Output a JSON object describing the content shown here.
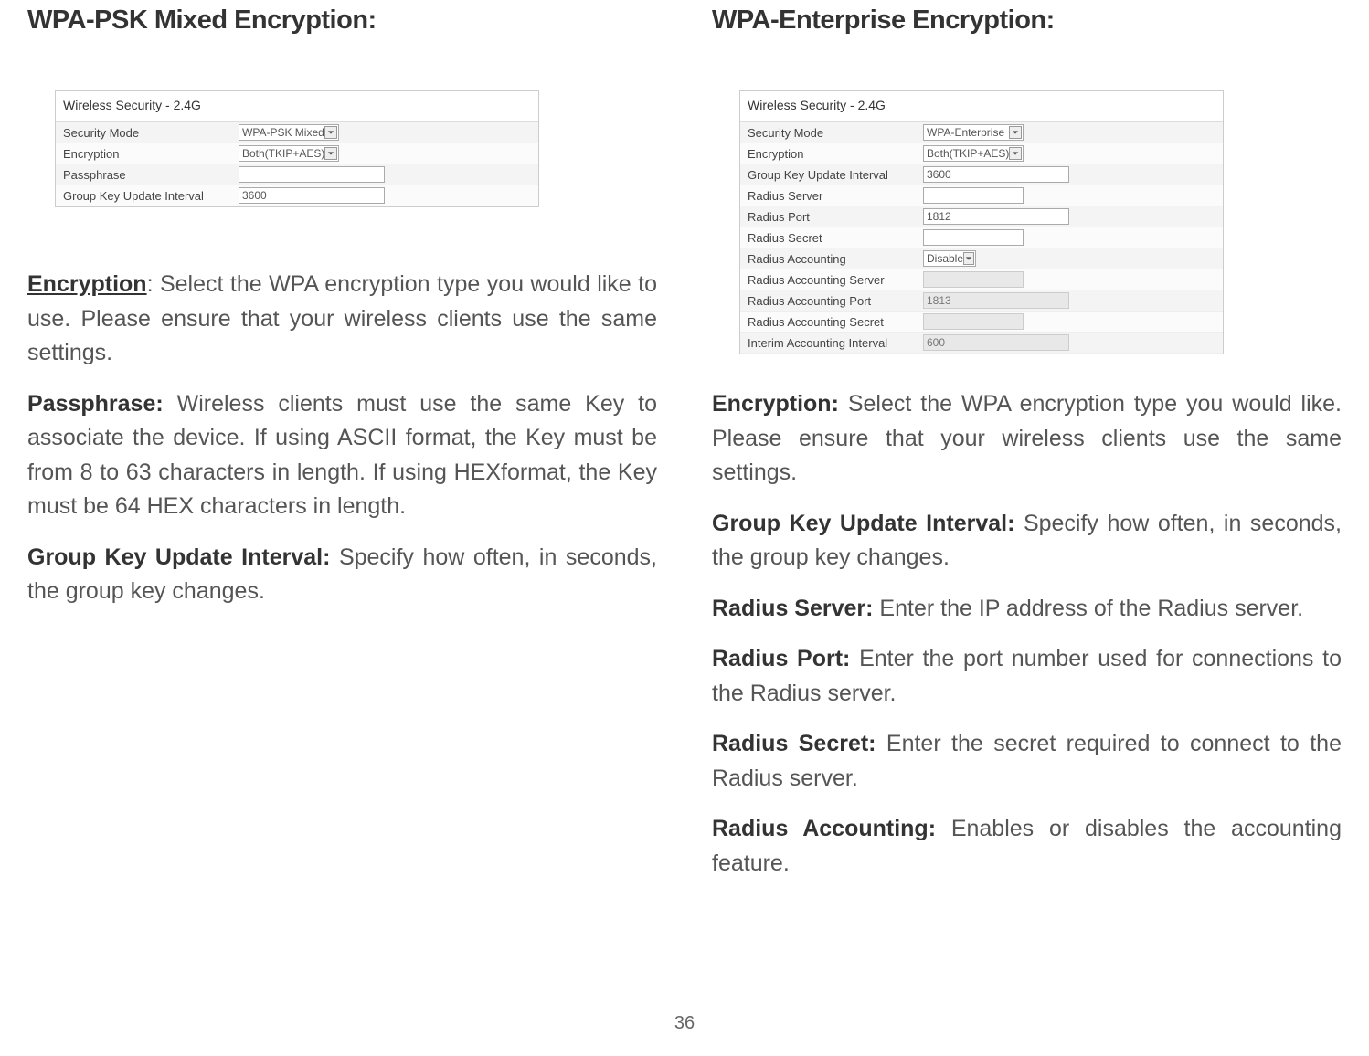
{
  "pageNumber": "36",
  "left": {
    "heading": "WPA-PSK Mixed Encryption:",
    "shotTitle": "Wireless Security - 2.4G",
    "rows": {
      "securityMode": {
        "label": "Security Mode",
        "value": "WPA-PSK Mixed"
      },
      "encryption": {
        "label": "Encryption",
        "value": "Both(TKIP+AES)"
      },
      "passphrase": {
        "label": "Passphrase",
        "value": ""
      },
      "groupKey": {
        "label": "Group Key Update Interval",
        "value": "3600"
      }
    },
    "paras": {
      "encryption": {
        "term": "Encryption",
        "text": ": Select the WPA encryption type you would like to use. Please ensure that your wireless clients use the same settings."
      },
      "passphrase": {
        "term": "Passphrase: ",
        "text": "Wireless clients must use the same Key to associate the device. If using ASCII format, the Key must be from 8 to 63 characters in length. If using HEXformat, the Key must be 64 HEX characters in length."
      },
      "groupKey": {
        "term": "Group Key Update Interval: ",
        "text": "Specify how often, in seconds, the group key changes."
      }
    }
  },
  "right": {
    "heading": "WPA-Enterprise Encryption:",
    "shotTitle": "Wireless Security - 2.4G",
    "rows": {
      "securityMode": {
        "label": "Security Mode",
        "value": "WPA-Enterprise"
      },
      "encryption": {
        "label": "Encryption",
        "value": "Both(TKIP+AES)"
      },
      "groupKey": {
        "label": "Group Key Update Interval",
        "value": "3600"
      },
      "radiusServer": {
        "label": "Radius Server",
        "value": ""
      },
      "radiusPort": {
        "label": "Radius Port",
        "value": "1812"
      },
      "radiusSecret": {
        "label": "Radius Secret",
        "value": ""
      },
      "radiusAccounting": {
        "label": "Radius Accounting",
        "value": "Disable"
      },
      "radiusAccServer": {
        "label": "Radius Accounting Server",
        "value": ""
      },
      "radiusAccPort": {
        "label": "Radius Accounting Port",
        "value": "1813"
      },
      "radiusAccSecret": {
        "label": "Radius Accounting Secret",
        "value": ""
      },
      "interimAcc": {
        "label": "Interim Accounting Interval",
        "value": "600"
      }
    },
    "paras": {
      "encryption": {
        "term": "Encryption: ",
        "text": "Select the WPA encryption type you would like. Please ensure that your wireless clients use the same settings."
      },
      "groupKey": {
        "term": "Group Key Update Interval: ",
        "text": "Specify how often, in seconds, the group key changes."
      },
      "radiusServer": {
        "term": "Radius Server: ",
        "text": "Enter the IP address of the Radius server."
      },
      "radiusPort": {
        "term": "Radius Port: ",
        "text": "Enter the port number used for connections to the Radius server."
      },
      "radiusSecret": {
        "term": "Radius Secret: ",
        "text": "Enter the secret required to connect to the Radius server."
      },
      "radiusAccounting": {
        "term": "Radius Accounting: ",
        "text": "Enables or disables the  accounting feature."
      }
    }
  }
}
